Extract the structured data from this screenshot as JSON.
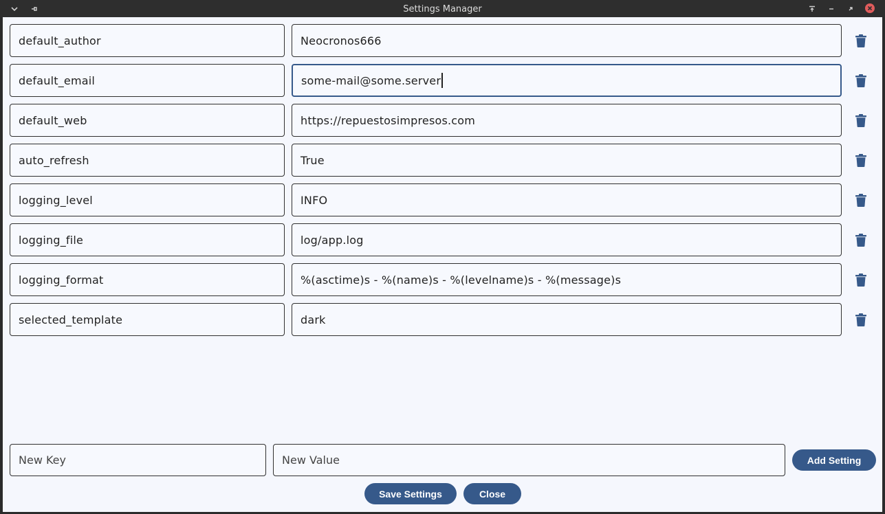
{
  "window": {
    "title": "Settings Manager"
  },
  "settings": [
    {
      "key": "default_author",
      "value": "Neocronos666"
    },
    {
      "key": "default_email",
      "value": "some-mail@some.server"
    },
    {
      "key": "default_web",
      "value": "https://repuestosimpresos.com"
    },
    {
      "key": "auto_refresh",
      "value": "True"
    },
    {
      "key": "logging_level",
      "value": "INFO"
    },
    {
      "key": "logging_file",
      "value": "log/app.log"
    },
    {
      "key": "logging_format",
      "value": "%(asctime)s - %(name)s - %(levelname)s - %(message)s"
    },
    {
      "key": "selected_template",
      "value": "dark"
    }
  ],
  "new_setting": {
    "key_placeholder": "New Key",
    "value_placeholder": "New Value",
    "add_label": "Add Setting"
  },
  "actions": {
    "save_label": "Save Settings",
    "close_label": "Close"
  },
  "icons": {
    "row_action": "trash-icon",
    "titlebar": [
      "chevron-down-icon",
      "pin-icon",
      "keep-above-icon",
      "minimize-icon",
      "restore-icon",
      "close-icon"
    ]
  },
  "colors": {
    "accent": "#36598a",
    "background": "#f5f7fd",
    "titlebar": "#2e2e2e",
    "close": "#e05c5c"
  }
}
